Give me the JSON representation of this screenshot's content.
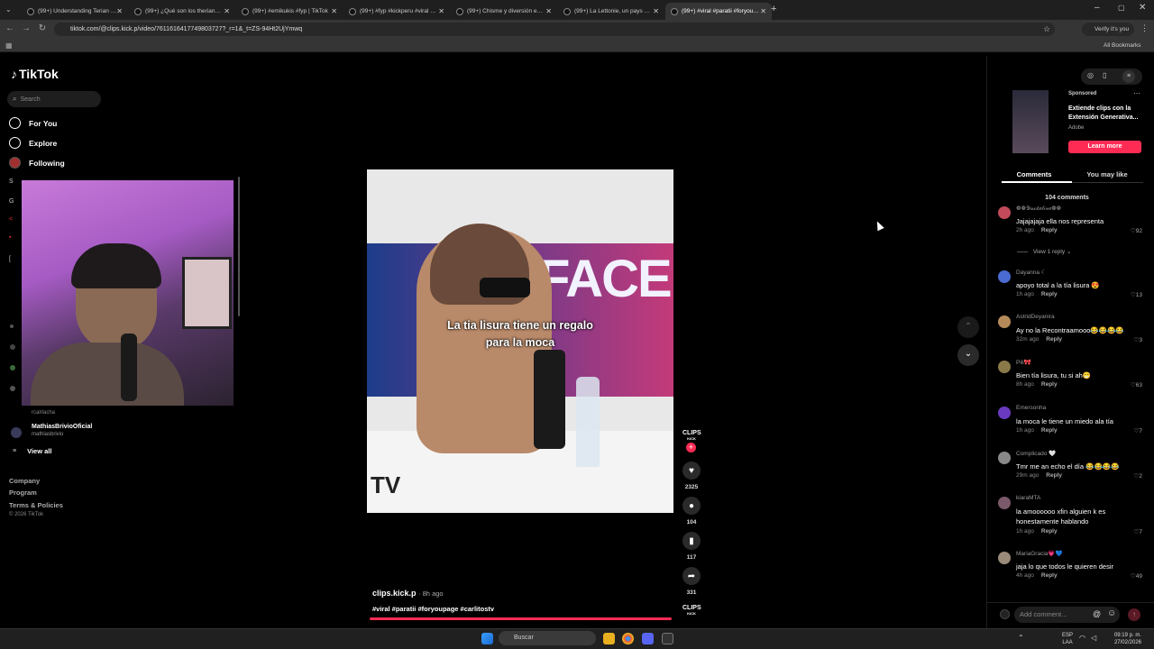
{
  "browser": {
    "tabs": [
      {
        "title": "(99+) Understanding Terian Va...",
        "active": false
      },
      {
        "title": "(99+) ¿Qué son los therian? De...",
        "active": false
      },
      {
        "title": "(99+) #emikukis #fyp | TikTok",
        "active": false
      },
      {
        "title": "(99+) #fyp #kickperu #viral #m...",
        "active": false
      },
      {
        "title": "(99+) Chisme y diversión en Mi...",
        "active": false
      },
      {
        "title": "(99+) La Lettonie, un pays peu...",
        "active": false
      },
      {
        "title": "(99+) #viral #paratii #foryoupa...",
        "active": true
      }
    ],
    "url": "tiktok.com/@clips.kick.p/video/7611616417749803727?_r=1&_t=ZS-94Ht2UjYmwq",
    "profile_label": "Verify it's you",
    "bookmarks_label": "All Bookmarks"
  },
  "sidebar": {
    "logo": "TikTok",
    "search_placeholder": "Search",
    "nav": [
      {
        "label": "For You"
      },
      {
        "label": "Explore"
      },
      {
        "label": "Following"
      }
    ],
    "following_account": {
      "name": "MathiasBrivioOficial",
      "handle": "mathiasbrivio"
    },
    "partial_handle": "rcalrlacha",
    "view_all": "View all",
    "footer": [
      "Company",
      "Program",
      "Terms & Policies"
    ],
    "copyright": "© 2026 TikTok"
  },
  "video": {
    "caption_line1": "La tia lisura tiene un regalo",
    "caption_line2": "para la moca",
    "studio_text": "FACE",
    "tv_text": "TV",
    "author": "clips.kick.p",
    "posted": "8h ago",
    "hashtags": "#viral #paratii #foryoupage #carlitostv",
    "logo_text": "CLIPS",
    "logo_sub": "KICK"
  },
  "actions": {
    "likes": "2325",
    "comments": "104",
    "saves": "117",
    "shares": "331"
  },
  "ad": {
    "label": "Sponsored",
    "title": "Extiende clips con la Extensión Generativa...",
    "brand": "Adobe",
    "cta": "Learn more"
  },
  "panel": {
    "tabs": [
      "Comments",
      "You may like"
    ],
    "comment_count": "104 comments",
    "view_reply": "View 1 reply",
    "reply_label": "Reply",
    "add_comment_placeholder": "Add comment...",
    "comments": [
      {
        "name": "❁❁𝒴𝒶𝒸𝓀𝑒𝓁𝒾𝓃𝑒❁❁",
        "text": "Jajajajaja ella nos representa",
        "time": "2h ago",
        "likes": "92",
        "color": "#c24a5a"
      },
      {
        "name": "Dayanna ☾",
        "text": "apoyo total a la tía lisura 😍",
        "time": "1h ago",
        "likes": "13",
        "color": "#4a6bd1"
      },
      {
        "name": "AstridDeyanira",
        "text": "Ay no la Recontraamooo😂😂😂😂",
        "time": "32m ago",
        "likes": "3",
        "color": "#b58a5a"
      },
      {
        "name": "Pili🎀",
        "text": "Bien tía lisura, tu si ah😁",
        "time": "8h ago",
        "likes": "63",
        "color": "#8a7a4a"
      },
      {
        "name": "Emersonha",
        "text": "la moca le tiene un miedo ala tía",
        "time": "1h ago",
        "likes": "7",
        "color": "#6a3ac1"
      },
      {
        "name": "Complicado 🤍",
        "text": "Tmr me an echo el día 😂😂😂😂",
        "time": "29m ago",
        "likes": "2",
        "color": "#888888"
      },
      {
        "name": "kiaraMTA",
        "text": "la amoooooo xfin alguien k es honestamente hablando",
        "time": "1h ago",
        "likes": "7",
        "color": "#7a5a6a"
      },
      {
        "name": "MariaGracia💗💙",
        "text": "jaja lo que todos le quieren desir",
        "time": "4h ago",
        "likes": "49",
        "color": "#9a8a7a"
      }
    ]
  },
  "taskbar": {
    "search_placeholder": "Buscar",
    "lang_line1": "ESP",
    "lang_line2": "LAA",
    "time": "09:19 p. m.",
    "date": "27/02/2026"
  },
  "colors": {
    "accent": "#fe2c55",
    "bg": "#000000"
  }
}
